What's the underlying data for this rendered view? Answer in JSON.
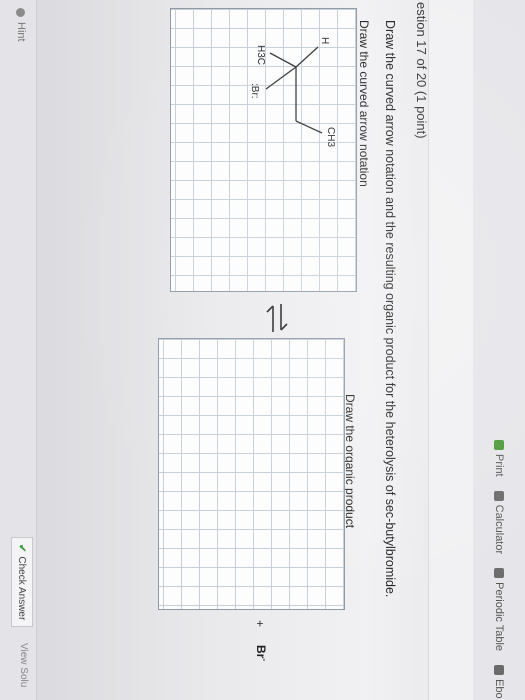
{
  "toolbar": {
    "print": "Print",
    "calculator": "Calculator",
    "periodic_table": "Periodic Table",
    "ebook": "Ebo"
  },
  "question": {
    "title": "estion 17 of 20 (1 point)",
    "prompt": "Draw the curved arrow notation and the resulting organic product for the heterolysis of sec-butylbromide.",
    "left_label": "Draw the curved arrow notation",
    "right_label": "Draw the organic product"
  },
  "molecule": {
    "h": "H",
    "br": ":Br:",
    "ch3": "CH3",
    "h3c": "H3C"
  },
  "products": {
    "plus": "+",
    "bromide": "Br",
    "bromide_charge": "-"
  },
  "footer": {
    "hint": "Hint",
    "check": "Check Answer",
    "view_solution": "View Solu"
  },
  "colors": {
    "grid_line": "#c5cfd9",
    "canvas_border": "#8f98a3",
    "check_tick": "#3a9a3a"
  },
  "icons": {
    "print": "printer-icon",
    "calculator": "calculator-icon",
    "periodic_table": "table-icon",
    "hint": "info-icon",
    "check": "checkmark-icon",
    "equilibrium": "equilibrium-arrows-icon"
  }
}
